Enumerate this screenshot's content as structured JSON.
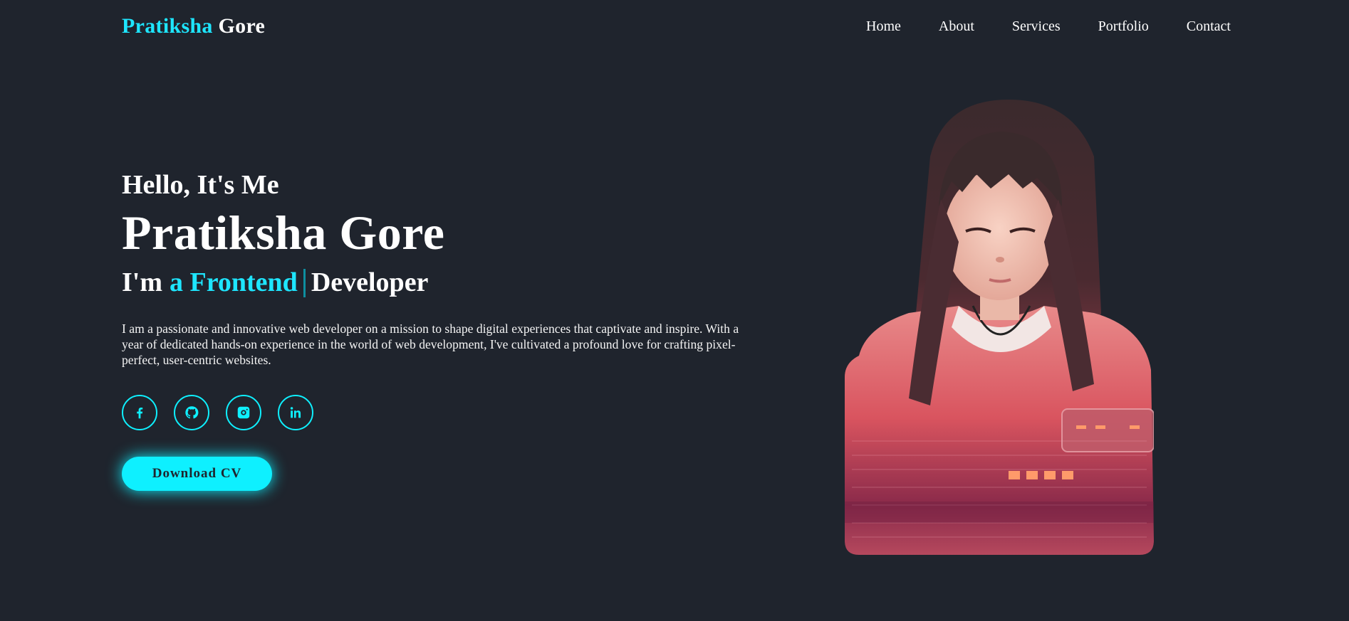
{
  "header": {
    "logo_first": "Pratiksha",
    "logo_last": "Gore",
    "nav": [
      "Home",
      "About",
      "Services",
      "Portfolio",
      "Contact"
    ]
  },
  "hero": {
    "greeting": "Hello, It's Me",
    "name": "Pratiksha Gore",
    "role_prefix": "I'm",
    "role_accent": "a Frontend",
    "role_suffix": "Developer",
    "description": "I am a passionate and innovative web developer on a mission to shape digital experiences that captivate and inspire. With a year of  dedicated hands-on experience in the world of  web development, I've cultivated a profound love for crafting pixel-perfect, user-centric websites.",
    "download_label": "Download CV"
  },
  "social_icons": [
    "facebook-icon",
    "github-icon",
    "instagram-icon",
    "linkedin-icon"
  ],
  "colors": {
    "background": "#1f242d",
    "accent": "#0ef0ff",
    "text": "#ffffff"
  }
}
